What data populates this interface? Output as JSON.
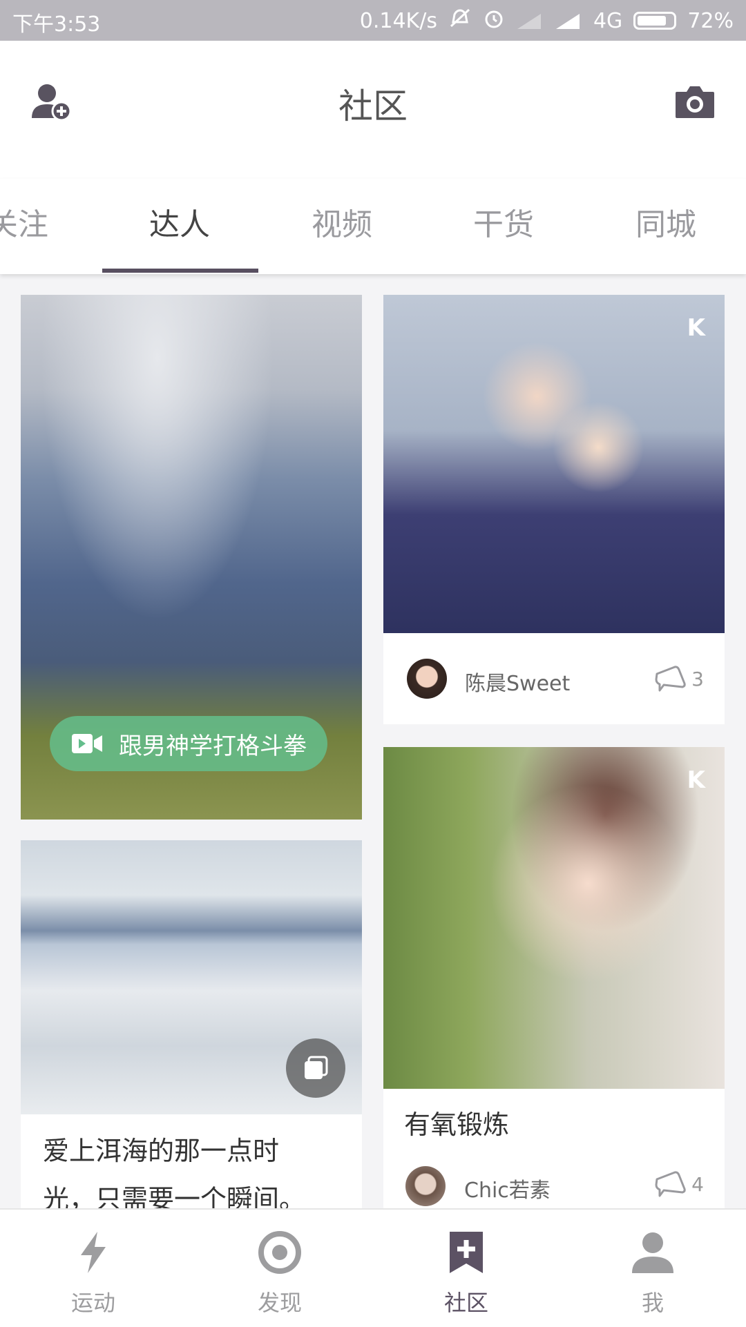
{
  "status_bar": {
    "time": "下午3:53",
    "network_speed": "0.14K/s",
    "network_type": "4G",
    "battery": "72%"
  },
  "header": {
    "title": "社区",
    "left_icon": "add-user-icon",
    "right_icon": "camera-icon"
  },
  "tabs": [
    {
      "label": "关注"
    },
    {
      "label": "达人",
      "active": true
    },
    {
      "label": "视频"
    },
    {
      "label": "干货"
    },
    {
      "label": "同城"
    }
  ],
  "feed": {
    "card1": {
      "video_pill_label": "跟男神学打格斗拳"
    },
    "card2": {
      "username": "陈晨Sweet",
      "comment_count": "3"
    },
    "card3": {
      "title_line1": "爱上洱海的那一点时",
      "title_line2": "光，只需要一个瞬间。"
    },
    "card4": {
      "title": "有氧锻炼",
      "username": "Chic若素",
      "comment_count": "4"
    }
  },
  "bottom_nav": [
    {
      "label": "运动",
      "icon": "lightning-icon"
    },
    {
      "label": "发现",
      "icon": "target-icon"
    },
    {
      "label": "社区",
      "icon": "bookmark-plus-icon",
      "active": true
    },
    {
      "label": "我",
      "icon": "person-icon"
    }
  ],
  "colors": {
    "status_bar_bg": "#b9b7bd",
    "accent": "#584f60",
    "video_pill": "#64be8c",
    "inactive_text": "#9d9d9f"
  }
}
